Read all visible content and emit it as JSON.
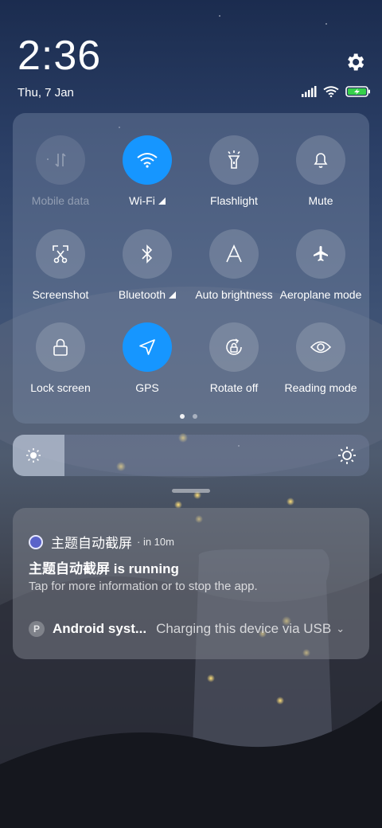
{
  "status": {
    "time": "2:36",
    "date": "Thu, 7 Jan",
    "battery_color": "#35d04a"
  },
  "tiles": [
    {
      "label": "Mobile data",
      "icon": "mobile-data-icon",
      "state": "disabled"
    },
    {
      "label": "Wi-Fi",
      "icon": "wifi-icon",
      "state": "on",
      "has_more": true
    },
    {
      "label": "Flashlight",
      "icon": "flashlight-icon",
      "state": "off"
    },
    {
      "label": "Mute",
      "icon": "bell-icon",
      "state": "off"
    },
    {
      "label": "Screenshot",
      "icon": "scissors-icon",
      "state": "off"
    },
    {
      "label": "Bluetooth",
      "icon": "bluetooth-icon",
      "state": "off",
      "has_more": true
    },
    {
      "label": "Auto brightness",
      "icon": "auto-brightness-icon",
      "state": "off"
    },
    {
      "label": "Aeroplane mode",
      "icon": "airplane-icon",
      "state": "off"
    },
    {
      "label": "Lock screen",
      "icon": "lock-icon",
      "state": "off"
    },
    {
      "label": "GPS",
      "icon": "location-arrow-icon",
      "state": "on"
    },
    {
      "label": "Rotate off",
      "icon": "rotate-lock-icon",
      "state": "off"
    },
    {
      "label": "Reading mode",
      "icon": "eye-icon",
      "state": "off"
    }
  ],
  "pager": {
    "pages": 2,
    "active": 1
  },
  "brightness": {
    "level": 0.145
  },
  "notification": {
    "app_name": "主题自动截屏",
    "time": "in 10m",
    "title": "主题自动截屏 is running",
    "text": "Tap for more information or to stop the app.",
    "secondary_app": "Android syst...",
    "secondary_text": "Charging this device via USB"
  },
  "colors": {
    "accent": "#1696ff"
  }
}
